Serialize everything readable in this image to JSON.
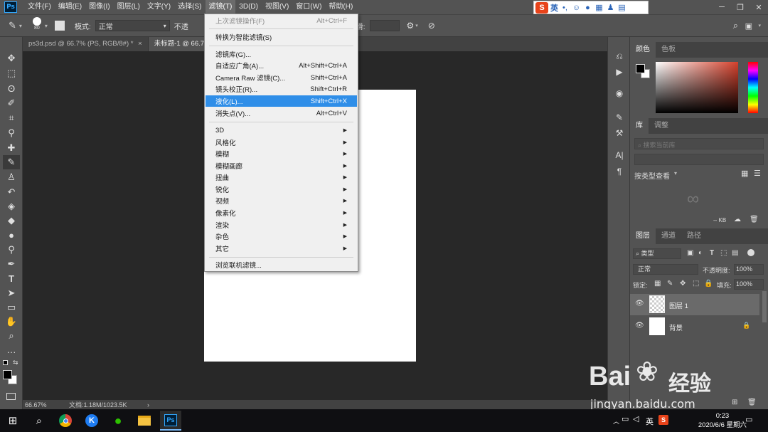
{
  "app": {
    "logo": "Ps"
  },
  "menubar": {
    "items": [
      "文件(F)",
      "编辑(E)",
      "图像(I)",
      "图层(L)",
      "文字(Y)",
      "选择(S)",
      "滤镜(T)",
      "3D(D)",
      "视图(V)",
      "窗口(W)",
      "帮助(H)"
    ],
    "active": "滤镜(T)"
  },
  "ime": {
    "logo": "S",
    "lang": "英"
  },
  "options": {
    "brush_size": "80",
    "mode_label": "模式:",
    "mode_value": "正常",
    "opacity_label": "不透",
    "smooth_label": "平滑:"
  },
  "tabs": [
    {
      "label": "ps3d.psd @ 66.7% (PS, RGB/8#) *",
      "close": "×"
    },
    {
      "label": "未标题-1 @ 66.7",
      "close": ""
    }
  ],
  "statusbar": {
    "zoom": "66.67%",
    "doc_info": "文档:1.18M/1023.5K",
    "arrow": "›"
  },
  "filter_menu": {
    "items": [
      {
        "label": "上次滤镜操作(F)",
        "shortcut": "Alt+Ctrl+F",
        "disabled": true
      },
      {
        "label": "转换为智能滤镜(S)",
        "shortcut": ""
      },
      {
        "label": "滤镜库(G)...",
        "shortcut": ""
      },
      {
        "label": "自适应广角(A)...",
        "shortcut": "Alt+Shift+Ctrl+A"
      },
      {
        "label": "Camera Raw 滤镜(C)...",
        "shortcut": "Shift+Ctrl+A"
      },
      {
        "label": "镜头校正(R)...",
        "shortcut": "Shift+Ctrl+R"
      },
      {
        "label": "液化(L)...",
        "shortcut": "Shift+Ctrl+X",
        "highlighted": true
      },
      {
        "label": "消失点(V)...",
        "shortcut": "Alt+Ctrl+V"
      }
    ],
    "submenus": [
      "3D",
      "风格化",
      "模糊",
      "模糊画廊",
      "扭曲",
      "锐化",
      "视频",
      "像素化",
      "渲染",
      "杂色",
      "其它"
    ],
    "browse": "浏览联机滤镜..."
  },
  "color_panel": {
    "tabs": [
      "颜色",
      "色板"
    ],
    "hue_color": "#d5412c"
  },
  "library_panel": {
    "tabs": [
      "库",
      "调整"
    ],
    "search_placeholder": "搜索当前库",
    "view_label": "按类型查看",
    "size_label": "-- KB"
  },
  "layers_panel": {
    "tabs": [
      "图层",
      "通道",
      "路径"
    ],
    "filter_label": "类型",
    "blend_mode": "正常",
    "opacity_label": "不透明度:",
    "opacity_value": "100%",
    "lock_label": "锁定:",
    "fill_label": "填充:",
    "fill_value": "100%",
    "layers": [
      {
        "name": "图层 1",
        "selected": true
      },
      {
        "name": "背景",
        "locked": true
      }
    ]
  },
  "taskbar": {
    "ime": "英",
    "time": "0:23",
    "date": "2020/6/6 星期六"
  },
  "watermark": {
    "brand": "Bai",
    "brand2": "经验",
    "url": "jingyan.baidu.com"
  }
}
